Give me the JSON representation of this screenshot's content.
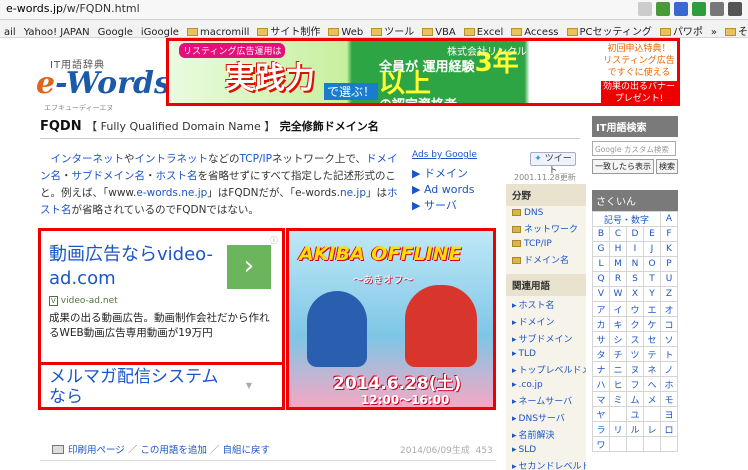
{
  "browser": {
    "url_host": "e-words.jp",
    "url_path": "/w/FQDN.html",
    "bookmarks": [
      {
        "label": "ail",
        "folder": false
      },
      {
        "label": "Yahoo! JAPAN",
        "folder": false
      },
      {
        "label": "Google",
        "folder": false
      },
      {
        "label": "iGoogle",
        "folder": false
      },
      {
        "label": "macromill",
        "folder": true
      },
      {
        "label": "サイト制作",
        "folder": true
      },
      {
        "label": "Web",
        "folder": true
      },
      {
        "label": "ツール",
        "folder": true
      },
      {
        "label": "VBA",
        "folder": true
      },
      {
        "label": "Excel",
        "folder": true
      },
      {
        "label": "Access",
        "folder": true
      },
      {
        "label": "PCセッティング",
        "folder": true
      },
      {
        "label": "パワポ",
        "folder": true
      },
      {
        "label": "»",
        "folder": false
      },
      {
        "label": "その他",
        "folder": true
      }
    ]
  },
  "header": {
    "logo_small": "IT用語辞典",
    "logo_e": "e",
    "logo_words": "-Words",
    "logo_sub": "エフキューディーエヌ"
  },
  "top_banner": {
    "tag": "リスティング広告運用は",
    "headline": "実践力",
    "tagline": "で選ぶ！",
    "line1": "全員が",
    "line2": "運用経験",
    "big": "3年以上",
    "line3": "の認定資格者",
    "company": "株式会社リンクル",
    "right_badge": "初回申込特典！",
    "right_text": "リスティング広告ですぐに使える",
    "right_button": "効果の出るバナー プレゼント!"
  },
  "term": {
    "name": "FQDN",
    "full": "【 Fully Qualified Domain Name 】",
    "ja": "完全修飾ドメイン名"
  },
  "description": {
    "p1_a": "インターネット",
    "p1_b": "や",
    "p1_c": "イントラネット",
    "p1_d": "などの",
    "p1_e": "TCP/IP",
    "p1_f": "ネットワーク上で、",
    "p1_g": "ドメイン名",
    "p1_h": "・",
    "p1_i": "サブドメイン名",
    "p1_j": "・",
    "p1_k": "ホスト名",
    "p1_l": "を省略せずにすべて指定した記述形式のこと。例えば、「www.",
    "p1_m": "e-words.ne.jp",
    "p1_n": "」はFQDNだが、「e-words.",
    "p1_o": "ne.jp",
    "p1_p": "」は",
    "p1_q": "ホスト名",
    "p1_r": "が省略されているのでFQDNではない。"
  },
  "ads_by": "Ads by Google",
  "ads_links": [
    "▶ ドメイン",
    "▶ Ad words",
    "▶ サーバ"
  ],
  "tweet_label": "ツイート",
  "updated": "2001.11.28更新",
  "ad_left": {
    "headline": "動画広告ならvideo-ad.com",
    "url": "video-ad.net",
    "body": "成果の出る動画広告。動画制作会社だから作れるWEB動画広告専用動画が19万円",
    "go": "›",
    "info": "ⓘ"
  },
  "ad_left_2": {
    "headline": "メルマガ配信システムなら",
    "arrow": "▼"
  },
  "ad_right": {
    "title": "AKIBA OFFLINE",
    "subtitle": "〜あきオフ〜",
    "date": "2014.6.28(土)",
    "time": "12:00〜16:00"
  },
  "footer": {
    "print": "印刷用ページ",
    "add": "この用語を追加",
    "report": "自組に戻す",
    "sep": "／",
    "date": "2014/06/09生成",
    "count": "453"
  },
  "mid_sidebar": {
    "section1": "分野",
    "items1": [
      "DNS",
      "ネットワーク",
      "TCP/IP",
      "ドメイン名"
    ],
    "section2": "関連用語",
    "items2": [
      "ホスト名",
      "ドメイン",
      "サブドメイン",
      "TLD",
      "トップレベルドメ...",
      ".co.jp",
      "ネームサーバ",
      "DNSサーバ",
      "名前解決",
      "SLD",
      "セカンドレベルド..."
    ]
  },
  "search": {
    "header": "IT用語検索",
    "placeholder": "Google カスタム検索",
    "btn1": "一致したら表示",
    "btn2": "検索"
  },
  "kana": {
    "header": "さくいん",
    "sub": "記号・数字",
    "rows": [
      [
        "記号・数字",
        "A"
      ],
      [
        "B",
        "C",
        "D",
        "E",
        "F"
      ],
      [
        "G",
        "H",
        "I",
        "J",
        "K"
      ],
      [
        "L",
        "M",
        "N",
        "O",
        "P"
      ],
      [
        "Q",
        "R",
        "S",
        "T",
        "U"
      ],
      [
        "V",
        "W",
        "X",
        "Y",
        "Z"
      ],
      [
        "ア",
        "イ",
        "ウ",
        "エ",
        "オ"
      ],
      [
        "カ",
        "キ",
        "ク",
        "ケ",
        "コ"
      ],
      [
        "サ",
        "シ",
        "ス",
        "セ",
        "ソ"
      ],
      [
        "タ",
        "チ",
        "ツ",
        "テ",
        "ト"
      ],
      [
        "ナ",
        "ニ",
        "ヌ",
        "ネ",
        "ノ"
      ],
      [
        "ハ",
        "ヒ",
        "フ",
        "ヘ",
        "ホ"
      ],
      [
        "マ",
        "ミ",
        "ム",
        "メ",
        "モ"
      ],
      [
        "ヤ",
        "",
        "ユ",
        "",
        "ヨ"
      ],
      [
        "ラ",
        "リ",
        "ル",
        "レ",
        "ロ"
      ],
      [
        "ワ",
        "",
        "",
        "",
        ""
      ]
    ]
  }
}
